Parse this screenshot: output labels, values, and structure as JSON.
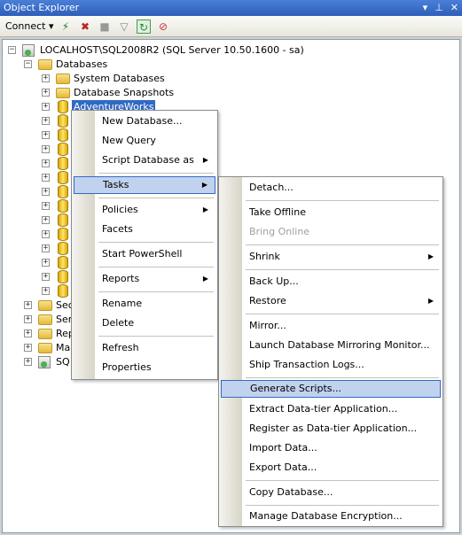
{
  "window": {
    "title": "Object Explorer",
    "pin_glyph": "▾",
    "pushpin_glyph": "⊥",
    "close_glyph": "✕"
  },
  "toolbar": {
    "connect_label": "Connect ▾",
    "icons": [
      "connect-icon",
      "disconnect-icon",
      "stop-icon",
      "filter-icon",
      "refresh-icon",
      "activity-monitor-icon"
    ]
  },
  "tree": {
    "server": {
      "label": "LOCALHOST\\SQL2008R2 (SQL Server 10.50.1600 - sa)"
    },
    "databases": {
      "label": "Databases"
    },
    "system_databases": {
      "label": "System Databases"
    },
    "database_snapshots": {
      "label": "Database Snapshots"
    },
    "selected_db": {
      "label": "AdventureWorks"
    },
    "partial_nodes": [
      "Sec",
      "Ser",
      "Rep",
      "Ma",
      "SQ"
    ]
  },
  "context_menu": {
    "items": [
      "New Database...",
      "New Query",
      "Script Database as",
      "Tasks",
      "Policies",
      "Facets",
      "Start PowerShell",
      "Reports",
      "Rename",
      "Delete",
      "Refresh",
      "Properties"
    ],
    "arrow_glyph": "▶"
  },
  "tasks_menu": {
    "items": [
      "Detach...",
      "Take Offline",
      "Bring Online",
      "Shrink",
      "Back Up...",
      "Restore",
      "Mirror...",
      "Launch Database Mirroring Monitor...",
      "Ship Transaction Logs...",
      "Generate Scripts...",
      "Extract Data-tier Application...",
      "Register as Data-tier Application...",
      "Import Data...",
      "Export Data...",
      "Copy Database...",
      "Manage Database Encryption..."
    ],
    "disabled_item": "Bring Online",
    "highlighted_item": "Generate Scripts..."
  },
  "colors": {
    "selection": "#316ac5",
    "menu_highlight": "#c1d2ee",
    "titlebar": "#3a6fcc"
  }
}
